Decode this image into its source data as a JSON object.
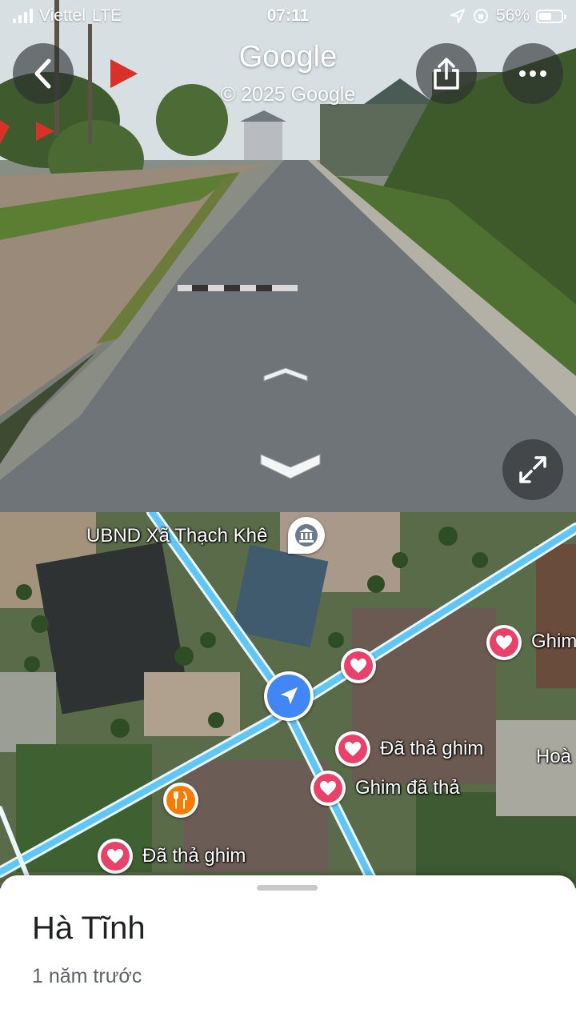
{
  "status_bar": {
    "carrier": "Viettel",
    "network": "LTE",
    "time": "07:11",
    "battery_percent": "56%",
    "battery_level": 0.56
  },
  "street_view": {
    "brand": "Google",
    "copyright": "© 2025 Google",
    "icons": {
      "back": "chevron-left-icon",
      "share": "share-icon",
      "more": "more-horizontal-icon",
      "forward": "chevron-up-icon",
      "backward": "chevron-down-icon",
      "expand": "expand-icon"
    }
  },
  "map": {
    "labels": {
      "ubnd": "UBND Xã Thạch Khê",
      "ghim_partial": "Ghim",
      "da_tha_ghim_1": "Đã thả ghim",
      "ghim_da_tha": "Ghim đã thả",
      "hoa_partial": "Hoà",
      "da_tha_ghim_2": "Đã thả ghim"
    },
    "colors": {
      "road": "#5fc6f5",
      "heart_pin": "#e8426b",
      "food_pin": "#f57c00",
      "location": "#4285f4"
    }
  },
  "sheet": {
    "title": "Hà Tĩnh",
    "subtitle": "1 năm trước"
  }
}
